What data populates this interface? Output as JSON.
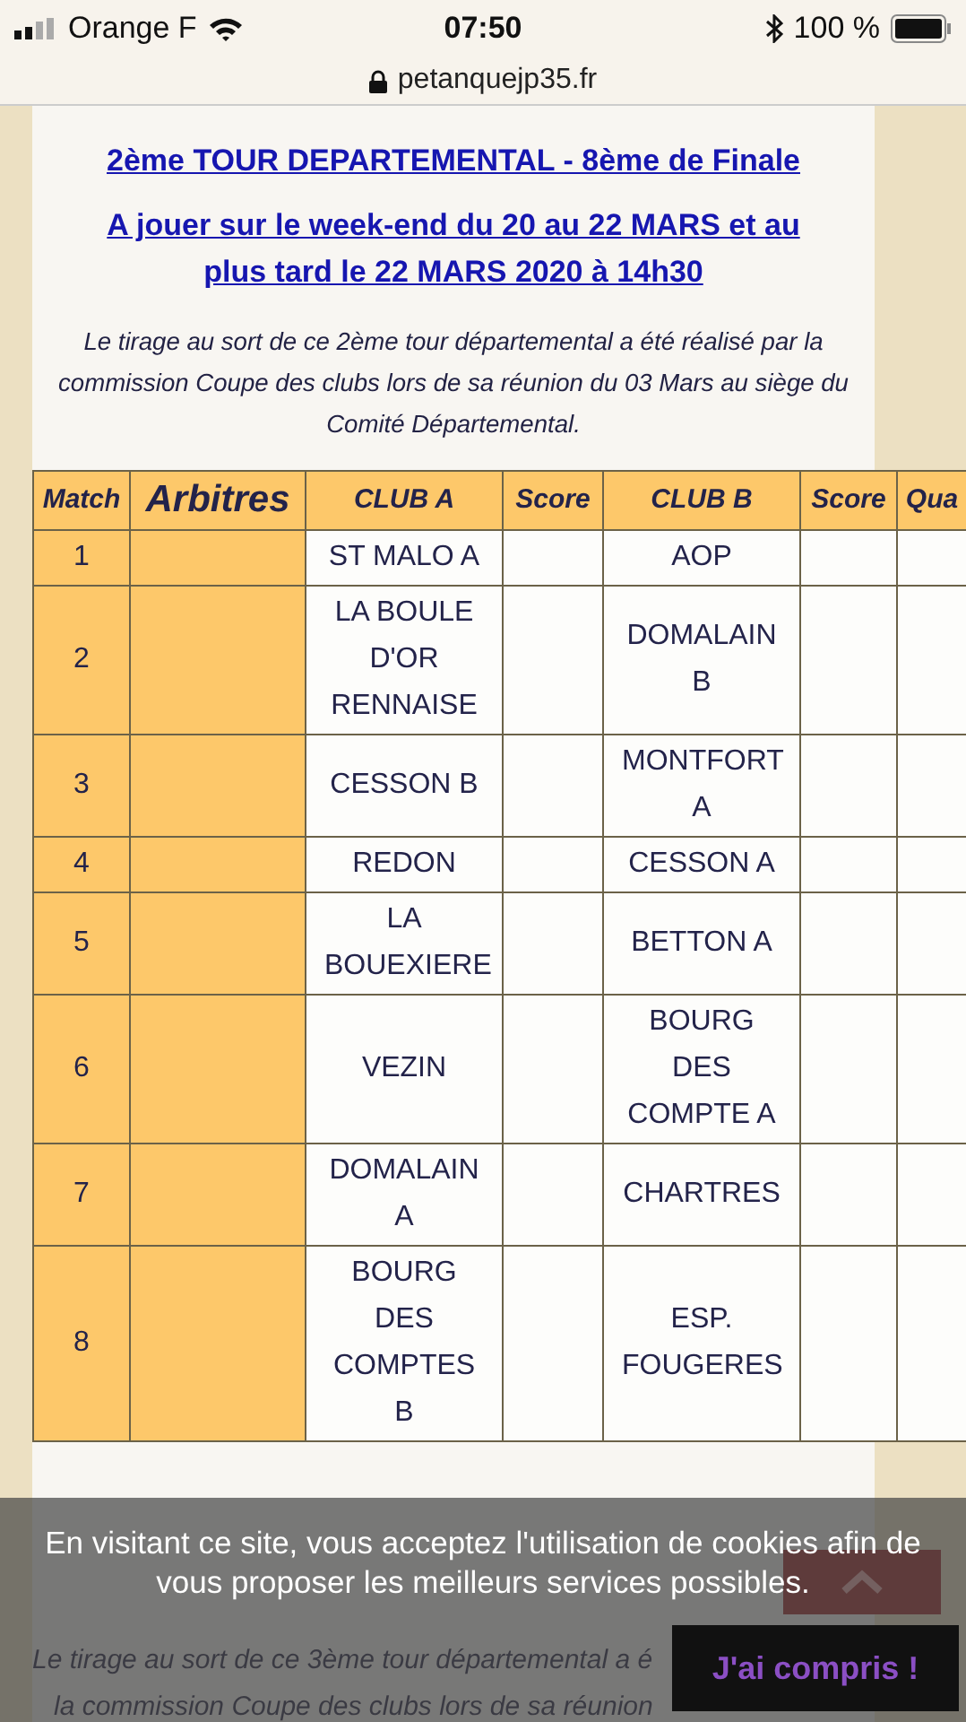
{
  "status_bar": {
    "carrier": "Orange F",
    "time": "07:50",
    "battery": "100 %"
  },
  "address_bar": {
    "url": "petanquejp35.fr"
  },
  "section": {
    "title": "2ème TOUR DEPARTEMENTAL - 8ème de Finale",
    "subtitle": "A jouer sur le week-end du 20 au 22 MARS et au plus tard le 22 MARS 2020 à 14h30",
    "intro": "Le tirage au sort de ce 2ème tour départemental a été réalisé par la commission Coupe des clubs lors de sa réunion du 03 Mars au siège du Comité Départemental."
  },
  "table": {
    "columns": [
      "Match",
      "Arbitres",
      "CLUB A",
      "Score",
      "CLUB B",
      "Score",
      "Qua"
    ],
    "rows": [
      {
        "match": "1",
        "club_a": "ST MALO A",
        "club_b": "AOP"
      },
      {
        "match": "2",
        "club_a": "LA BOULE D'OR RENNAISE",
        "club_b": "DOMALAIN B"
      },
      {
        "match": "3",
        "club_a": "CESSON B",
        "club_b": "MONTFORT A"
      },
      {
        "match": "4",
        "club_a": "REDON",
        "club_b": "CESSON A"
      },
      {
        "match": "5",
        "club_a": "LA BOUEXIERE",
        "club_b": "BETTON A"
      },
      {
        "match": "6",
        "club_a": "VEZIN",
        "club_b": "BOURG DES COMPTE A"
      },
      {
        "match": "7",
        "club_a": "DOMALAIN A",
        "club_b": "CHARTRES"
      },
      {
        "match": "8",
        "club_a": "BOURG DES COMPTES B",
        "club_b": "ESP. FOUGERES"
      }
    ]
  },
  "next_section": {
    "intro_lines": [
      "Le tirage au sort de ce 3ème tour départemental a é",
      "la commission Coupe des clubs lors de sa réunion"
    ]
  },
  "cookie_banner": {
    "message": "En visitant ce site, vous acceptez l'utilisation de cookies afin de vous proposer les meilleurs services possibles.",
    "accept": "J'ai compris !"
  }
}
